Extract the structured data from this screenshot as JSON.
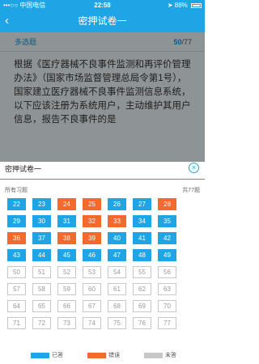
{
  "status_bar": {
    "carrier": "•••○○ 中国电信",
    "time": "22:58",
    "battery": "88%"
  },
  "nav": {
    "back_icon": "chevron-left-icon",
    "title": "密押试卷一"
  },
  "question": {
    "type": "多选题",
    "current": "50",
    "total": "/77",
    "text": "根据《医疗器械不良事件监测和再评价管理办法》（国家市场监督管理总局令第1号），国家建立医疗器械不良事件监测信息系统，以下应该注册为系统用户，主动维护其用户信息，报告不良事件的是"
  },
  "sheet": {
    "title": "密押试卷一",
    "close_icon": "close-icon",
    "subtitle_left": "所有习题",
    "subtitle_right": "共77题",
    "cells": [
      {
        "n": "22",
        "s": "answered"
      },
      {
        "n": "23",
        "s": "answered"
      },
      {
        "n": "24",
        "s": "wrong"
      },
      {
        "n": "25",
        "s": "wrong"
      },
      {
        "n": "26",
        "s": "answered"
      },
      {
        "n": "27",
        "s": "answered"
      },
      {
        "n": "28",
        "s": "wrong"
      },
      {
        "n": "29",
        "s": "answered"
      },
      {
        "n": "30",
        "s": "answered"
      },
      {
        "n": "31",
        "s": "answered"
      },
      {
        "n": "32",
        "s": "wrong"
      },
      {
        "n": "33",
        "s": "wrong"
      },
      {
        "n": "34",
        "s": "answered"
      },
      {
        "n": "35",
        "s": "answered"
      },
      {
        "n": "36",
        "s": "wrong"
      },
      {
        "n": "37",
        "s": "answered"
      },
      {
        "n": "38",
        "s": "wrong"
      },
      {
        "n": "39",
        "s": "wrong"
      },
      {
        "n": "40",
        "s": "answered"
      },
      {
        "n": "41",
        "s": "answered"
      },
      {
        "n": "42",
        "s": "answered"
      },
      {
        "n": "43",
        "s": "answered"
      },
      {
        "n": "44",
        "s": "answered"
      },
      {
        "n": "45",
        "s": "answered"
      },
      {
        "n": "46",
        "s": "answered"
      },
      {
        "n": "47",
        "s": "answered"
      },
      {
        "n": "48",
        "s": "answered"
      },
      {
        "n": "49",
        "s": "answered"
      },
      {
        "n": "50",
        "s": "unanswered"
      },
      {
        "n": "51",
        "s": "unanswered"
      },
      {
        "n": "52",
        "s": "unanswered"
      },
      {
        "n": "53",
        "s": "unanswered"
      },
      {
        "n": "54",
        "s": "unanswered"
      },
      {
        "n": "55",
        "s": "unanswered"
      },
      {
        "n": "56",
        "s": "unanswered"
      },
      {
        "n": "57",
        "s": "unanswered"
      },
      {
        "n": "58",
        "s": "unanswered"
      },
      {
        "n": "59",
        "s": "unanswered"
      },
      {
        "n": "60",
        "s": "unanswered"
      },
      {
        "n": "61",
        "s": "unanswered"
      },
      {
        "n": "62",
        "s": "unanswered"
      },
      {
        "n": "63",
        "s": "unanswered"
      },
      {
        "n": "64",
        "s": "unanswered"
      },
      {
        "n": "65",
        "s": "unanswered"
      },
      {
        "n": "66",
        "s": "unanswered"
      },
      {
        "n": "67",
        "s": "unanswered"
      },
      {
        "n": "68",
        "s": "unanswered"
      },
      {
        "n": "69",
        "s": "unanswered"
      },
      {
        "n": "70",
        "s": "unanswered"
      },
      {
        "n": "71",
        "s": "unanswered"
      },
      {
        "n": "72",
        "s": "unanswered"
      },
      {
        "n": "73",
        "s": "unanswered"
      },
      {
        "n": "74",
        "s": "unanswered"
      },
      {
        "n": "75",
        "s": "unanswered"
      },
      {
        "n": "76",
        "s": "unanswered"
      },
      {
        "n": "77",
        "s": "unanswered"
      }
    ]
  },
  "legend": {
    "answered": "已答",
    "wrong": "错误",
    "unanswered": "未答"
  },
  "colors": {
    "accent": "#1fa5e6",
    "wrong": "#f36a2c",
    "unanswered_border": "#c7c7c7",
    "overlay": "#8e9496"
  }
}
